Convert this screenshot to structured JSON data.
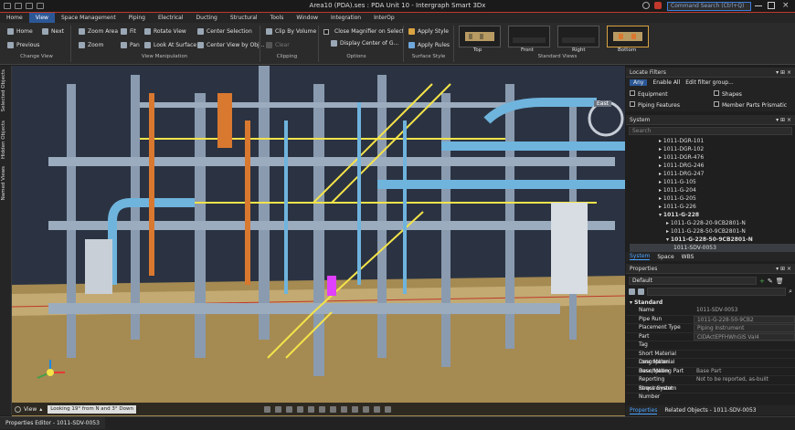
{
  "window": {
    "title": "Area10 (PDA).ses : PDA Unit 10 - Intergraph Smart 3Dx",
    "search_placeholder": "Command Search (Ctrl+Q)"
  },
  "ribbon_tabs": [
    "Home",
    "View",
    "Space Management",
    "Piping",
    "Electrical",
    "Ducting",
    "Structural",
    "Tools",
    "Window",
    "Integration",
    "InterOp"
  ],
  "active_tab": "View",
  "ribbon": {
    "home": "Home",
    "next": "Next",
    "previous": "Previous",
    "change_view": "Change View",
    "zoom_area": "Zoom Area",
    "fit": "Fit",
    "rotate_view": "Rotate View",
    "center_selection": "Center Selection",
    "zoom": "Zoom",
    "pan": "Pan",
    "look_at_surface": "Look At Surface",
    "center_view_by_obj": "Center View by Obj...",
    "view_manipulation": "View Manipulation",
    "clip_by_volume": "Clip By Volume",
    "clear": "Clear",
    "clipping": "Clipping",
    "close_magnifier": "Close Magnifier on Select",
    "display_center": "Display Center of G...",
    "options": "Options",
    "apply_style": "Apply Style",
    "apply_rules": "Apply Rules",
    "surface_style": "Surface Style",
    "std_views": [
      "Top",
      "Front",
      "Right",
      "Bottom"
    ],
    "standard_views": "Standard Views"
  },
  "left_strip": [
    "Selected Objects",
    "Hidden Objects",
    "Named Views"
  ],
  "viewport": {
    "compass": "East",
    "view_label": "View",
    "looking": "Looking 19° from N and 3° Down"
  },
  "locate_filters": {
    "title": "Locate Filters",
    "any": "Any",
    "enable_all": "Enable All",
    "edit_filter": "Edit filter group...",
    "items": [
      "Equipment",
      "Shapes",
      "Piping Features",
      "Member Parts Prismatic"
    ]
  },
  "system": {
    "title": "System",
    "search_placeholder": "Search",
    "tree": [
      {
        "label": "1011-DGR-101",
        "level": 1,
        "bold": false
      },
      {
        "label": "1011-DGR-102",
        "level": 1,
        "bold": false
      },
      {
        "label": "1011-DGR-476",
        "level": 1,
        "bold": false
      },
      {
        "label": "1011-DRG-246",
        "level": 1,
        "bold": false
      },
      {
        "label": "1011-DRG-247",
        "level": 1,
        "bold": false
      },
      {
        "label": "1011-G-105",
        "level": 1,
        "bold": false
      },
      {
        "label": "1011-G-204",
        "level": 1,
        "bold": false
      },
      {
        "label": "1011-G-205",
        "level": 1,
        "bold": false
      },
      {
        "label": "1011-G-226",
        "level": 1,
        "bold": false
      },
      {
        "label": "1011-G-228",
        "level": 1,
        "bold": true
      },
      {
        "label": "1011-G-228-20-9CB2801-N",
        "level": 2,
        "bold": false
      },
      {
        "label": "1011-G-228-50-9CB2801-N",
        "level": 2,
        "bold": false
      },
      {
        "label": "1011-G-228-50-9CB2801-N",
        "level": 2,
        "bold": true
      },
      {
        "label": "1011-SDV-0053",
        "level": 3,
        "bold": false
      }
    ],
    "tabs": [
      "System",
      "Space",
      "WBS"
    ]
  },
  "properties": {
    "title": "Properties",
    "dropdown": "Default",
    "section": "Standard",
    "rows": [
      {
        "k": "Name",
        "v": "1011-SDV-0053"
      },
      {
        "k": "Pipe Run",
        "v": "1011-G-228-50-9CB2"
      },
      {
        "k": "Placement Type",
        "v": "Piping Instrument"
      },
      {
        "k": "Part",
        "v": "CIDActEPFHWhGIS Val4"
      },
      {
        "k": "Tag",
        "v": ""
      },
      {
        "k": "Short Material Description",
        "v": ""
      },
      {
        "k": "Long Material Description",
        "v": ""
      },
      {
        "k": "Base/Mating Part",
        "v": "Base Part"
      },
      {
        "k": "Reporting Requirement",
        "v": "Not to be reported, as-built"
      },
      {
        "k": "Stress System Number",
        "v": ""
      }
    ],
    "tabs": [
      "Properties",
      "Related Objects - 1011-SDV-0053"
    ]
  },
  "status": {
    "text": "Properties Editor - 1011-SDV-0053"
  },
  "colors": {
    "accent": "#2b5797",
    "steel": "#8a9bb0",
    "handrail": "#f4e44a",
    "pipe": "#6fb4dd",
    "orange": "#d9782f",
    "ground": "#a58a52",
    "selection": "#e040fb"
  }
}
